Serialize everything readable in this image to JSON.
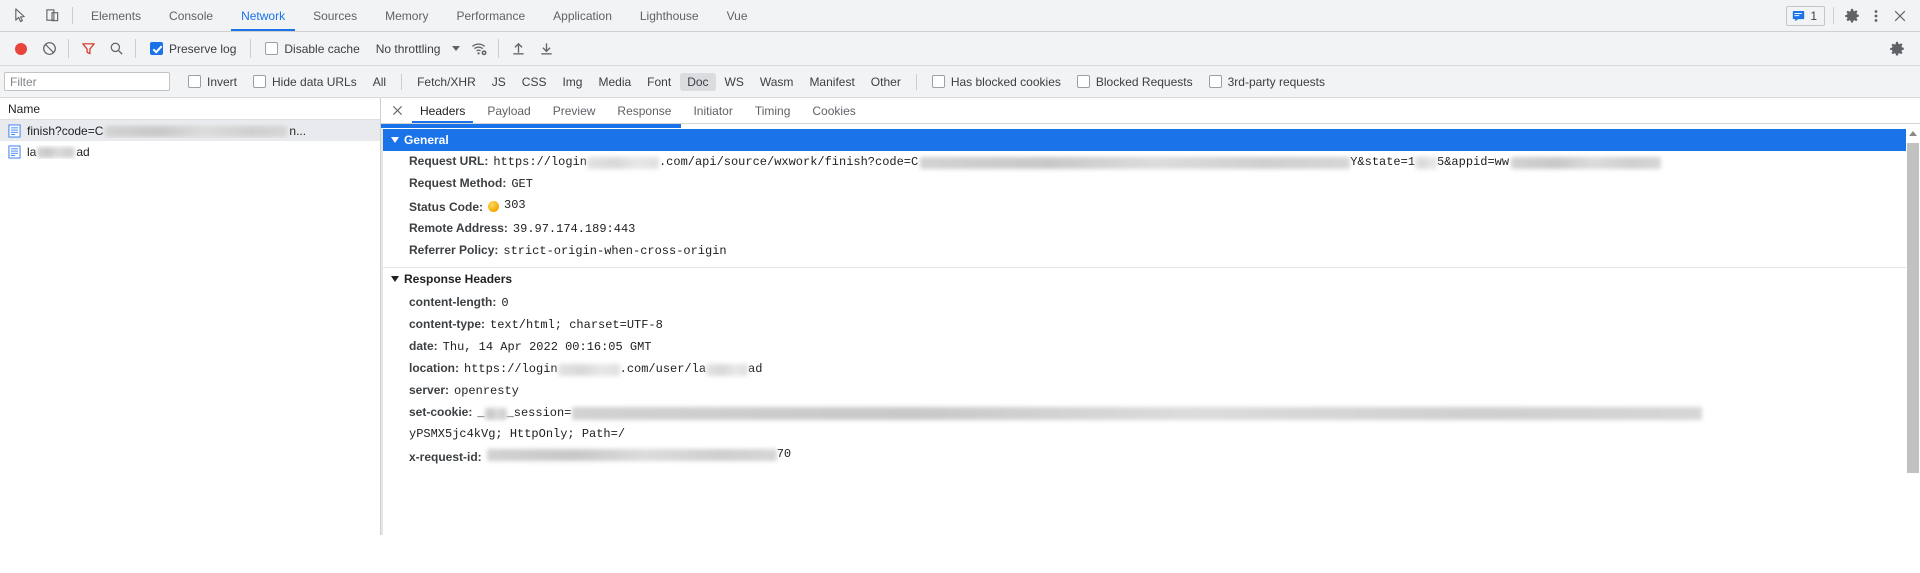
{
  "devtools": {
    "main_tabs": [
      {
        "label": "Elements",
        "selected": false
      },
      {
        "label": "Console",
        "selected": false
      },
      {
        "label": "Network",
        "selected": true
      },
      {
        "label": "Sources",
        "selected": false
      },
      {
        "label": "Memory",
        "selected": false
      },
      {
        "label": "Performance",
        "selected": false
      },
      {
        "label": "Application",
        "selected": false
      },
      {
        "label": "Lighthouse",
        "selected": false
      },
      {
        "label": "Vue",
        "selected": false
      }
    ],
    "inspect_icon": "inspect-element-icon",
    "device_icon": "device-toolbar-icon",
    "message_count": "1",
    "settings_icon": "gear-icon",
    "more_icon": "kebab-menu-icon",
    "close_icon": "close-icon",
    "accent_color": "#1a73e8",
    "toolbar_bg": "#f1f3f4"
  },
  "network_toolbar": {
    "record_label": "record-button",
    "clear_label": "clear-button",
    "filter_toggle_label": "filter-toggle",
    "search_label": "search-button",
    "preserve_log": {
      "label": "Preserve log",
      "checked": true
    },
    "disable_cache": {
      "label": "Disable cache",
      "checked": false
    },
    "throttling": {
      "value": "No throttling"
    },
    "network_conditions_icon": "wifi-settings-icon",
    "import_icon": "import-har-icon",
    "export_icon": "export-har-icon",
    "settings_icon": "gear-icon"
  },
  "filter_bar": {
    "input_placeholder": "Filter",
    "input_value": "",
    "invert": {
      "label": "Invert",
      "checked": false
    },
    "hide_data_urls": {
      "label": "Hide data URLs",
      "checked": false
    },
    "types": [
      {
        "label": "All",
        "active": false
      },
      {
        "label": "Fetch/XHR",
        "active": false
      },
      {
        "label": "JS",
        "active": false
      },
      {
        "label": "CSS",
        "active": false
      },
      {
        "label": "Img",
        "active": false
      },
      {
        "label": "Media",
        "active": false
      },
      {
        "label": "Font",
        "active": false
      },
      {
        "label": "Doc",
        "active": true
      },
      {
        "label": "WS",
        "active": false
      },
      {
        "label": "Wasm",
        "active": false
      },
      {
        "label": "Manifest",
        "active": false
      },
      {
        "label": "Other",
        "active": false
      }
    ],
    "has_blocked_cookies": {
      "label": "Has blocked cookies",
      "checked": false
    },
    "blocked_requests": {
      "label": "Blocked Requests",
      "checked": false
    },
    "third_party_requests": {
      "label": "3rd-party requests",
      "checked": false
    }
  },
  "request_list": {
    "column_header": "Name",
    "rows": [
      {
        "prefix": "finish?code=C",
        "suffix": "n...",
        "selected": true,
        "icon": "document-icon"
      },
      {
        "prefix": "la",
        "suffix": "ad",
        "selected": false,
        "icon": "document-icon"
      }
    ]
  },
  "detail_tabs": {
    "close_icon": "close-icon",
    "tabs": [
      {
        "label": "Headers",
        "selected": true
      },
      {
        "label": "Payload",
        "selected": false
      },
      {
        "label": "Preview",
        "selected": false
      },
      {
        "label": "Response",
        "selected": false
      },
      {
        "label": "Initiator",
        "selected": false
      },
      {
        "label": "Timing",
        "selected": false
      },
      {
        "label": "Cookies",
        "selected": false
      }
    ]
  },
  "general": {
    "section_title": "General",
    "request_url": {
      "key": "Request URL:",
      "part1": "https://login",
      "part2": ".com/api/source/wxwork/finish?code=C",
      "part3": "Y&state=1",
      "part4": "5&appid=ww"
    },
    "request_method": {
      "key": "Request Method:",
      "value": "GET"
    },
    "status_code": {
      "key": "Status Code:",
      "value": "303",
      "indicator_color": "#f2a900"
    },
    "remote_address": {
      "key": "Remote Address:",
      "value": "39.97.174.189:443"
    },
    "referrer_policy": {
      "key": "Referrer Policy:",
      "value": "strict-origin-when-cross-origin"
    }
  },
  "response_headers": {
    "section_title": "Response Headers",
    "content_length": {
      "key": "content-length:",
      "value": "0"
    },
    "content_type": {
      "key": "content-type:",
      "value": "text/html; charset=UTF-8"
    },
    "date": {
      "key": "date:",
      "value": "Thu, 14 Apr 2022 00:16:05 GMT"
    },
    "location": {
      "key": "location:",
      "part1": "https://login",
      "part2": ".com/user/la",
      "part3": "ad"
    },
    "server": {
      "key": "server:",
      "value": "openresty"
    },
    "set_cookie": {
      "key": "set-cookie:",
      "part1": "_",
      "part2": "_session=",
      "continuation": "yPSMX5jc4kVg; HttpOnly; Path=/"
    },
    "x_request_id": {
      "key": "x-request-id:",
      "part1": "",
      "suffix": "70"
    }
  }
}
